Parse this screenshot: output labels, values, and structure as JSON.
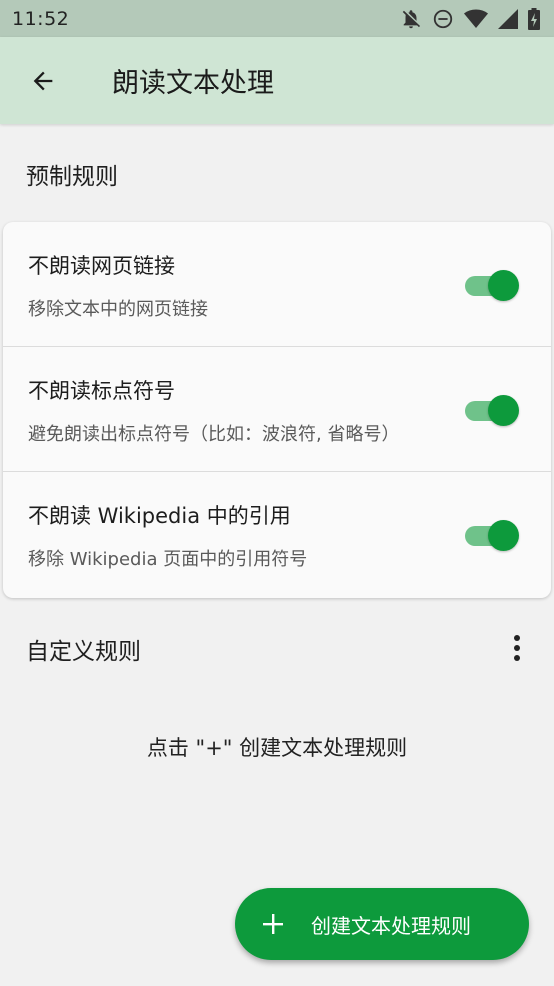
{
  "status_bar": {
    "time": "11:52",
    "icons": [
      "notifications-off-icon",
      "do-not-disturb-icon",
      "wifi-icon",
      "cellular-signal-icon",
      "battery-charging-icon"
    ]
  },
  "app_bar": {
    "back_icon": "arrow-back-icon",
    "title": "朗读文本处理"
  },
  "preset_section": {
    "title": "预制规则",
    "rules": [
      {
        "title": "不朗读网页链接",
        "description": "移除文本中的网页链接",
        "enabled": true
      },
      {
        "title": "不朗读标点符号",
        "description": "避免朗读出标点符号（比如：波浪符, 省略号）",
        "enabled": true
      },
      {
        "title": "不朗读 Wikipedia 中的引用",
        "description": "移除 Wikipedia 页面中的引用符号",
        "enabled": true
      }
    ]
  },
  "custom_section": {
    "title": "自定义规则",
    "menu_icon": "more-vert-icon",
    "empty_hint": "点击 \"+\" 创建文本处理规则"
  },
  "fab": {
    "icon": "plus-icon",
    "label": "创建文本处理规则"
  },
  "colors": {
    "accent": "#0d9a3c",
    "accent_track": "#6fc28a",
    "app_bar_bg": "#cfe5d4",
    "status_bar_bg": "#b4c9b9",
    "page_bg": "#f1f1f1"
  }
}
